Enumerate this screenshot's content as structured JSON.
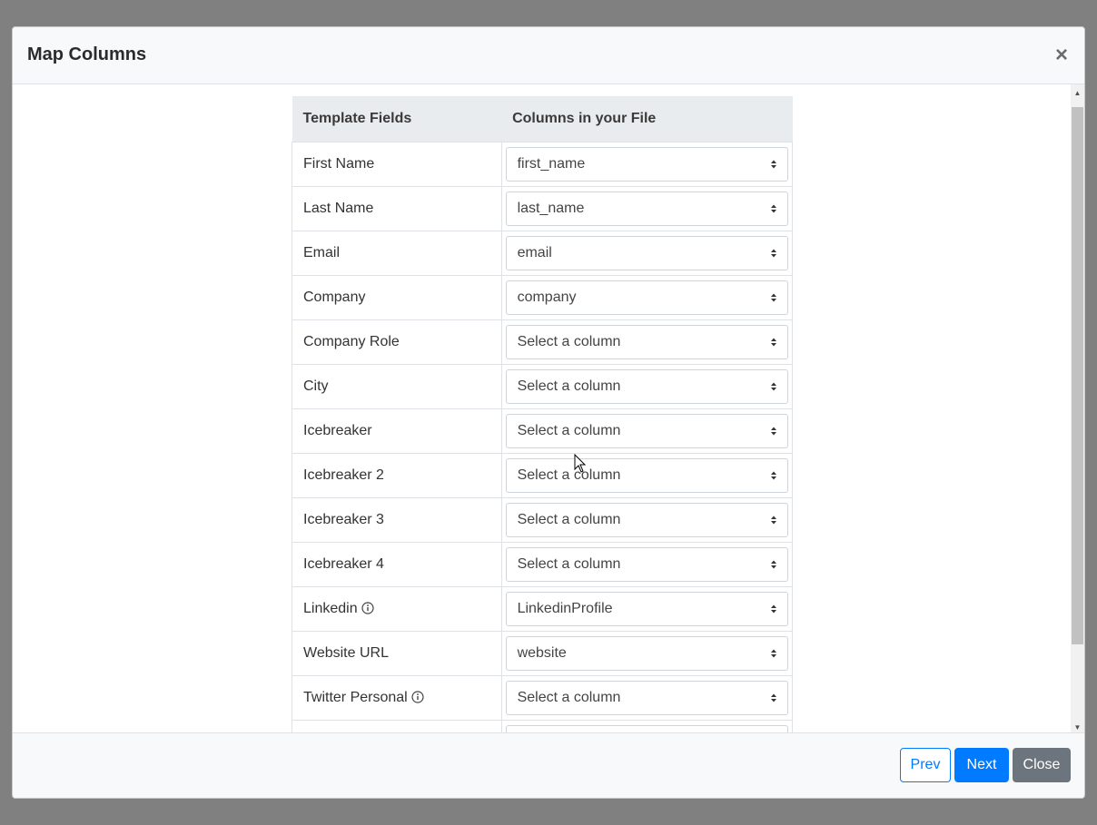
{
  "modal": {
    "title": "Map Columns",
    "close_symbol": "×"
  },
  "table": {
    "headers": [
      "Template Fields",
      "Columns in your File"
    ],
    "rows": [
      {
        "field": "First Name",
        "value": "first_name",
        "info": false
      },
      {
        "field": "Last Name",
        "value": "last_name",
        "info": false
      },
      {
        "field": "Email",
        "value": "email",
        "info": false
      },
      {
        "field": "Company",
        "value": "company",
        "info": false
      },
      {
        "field": "Company Role",
        "value": "Select a column",
        "info": false
      },
      {
        "field": "City",
        "value": "Select a column",
        "info": false
      },
      {
        "field": "Icebreaker",
        "value": "Select a column",
        "info": false
      },
      {
        "field": "Icebreaker 2",
        "value": "Select a column",
        "info": false
      },
      {
        "field": "Icebreaker 3",
        "value": "Select a column",
        "info": false
      },
      {
        "field": "Icebreaker 4",
        "value": "Select a column",
        "info": false
      },
      {
        "field": "Linkedin",
        "value": "LinkedinProfile",
        "info": true
      },
      {
        "field": "Website URL",
        "value": "website",
        "info": false
      },
      {
        "field": "Twitter Personal",
        "value": "Select a column",
        "info": true
      },
      {
        "field": "",
        "value": "",
        "info": false
      }
    ]
  },
  "footer": {
    "prev_label": "Prev",
    "next_label": "Next",
    "close_label": "Close"
  },
  "icons": {
    "close": "close-icon",
    "info": "info-circle-icon",
    "select_arrows": "sort-arrows-icon",
    "scroll_up": "scroll-up-arrow-icon",
    "scroll_down": "scroll-down-arrow-icon"
  },
  "colors": {
    "primary": "#007bff",
    "secondary": "#6c757d",
    "header_bg": "#e9ecef",
    "backdrop": "#808080"
  }
}
